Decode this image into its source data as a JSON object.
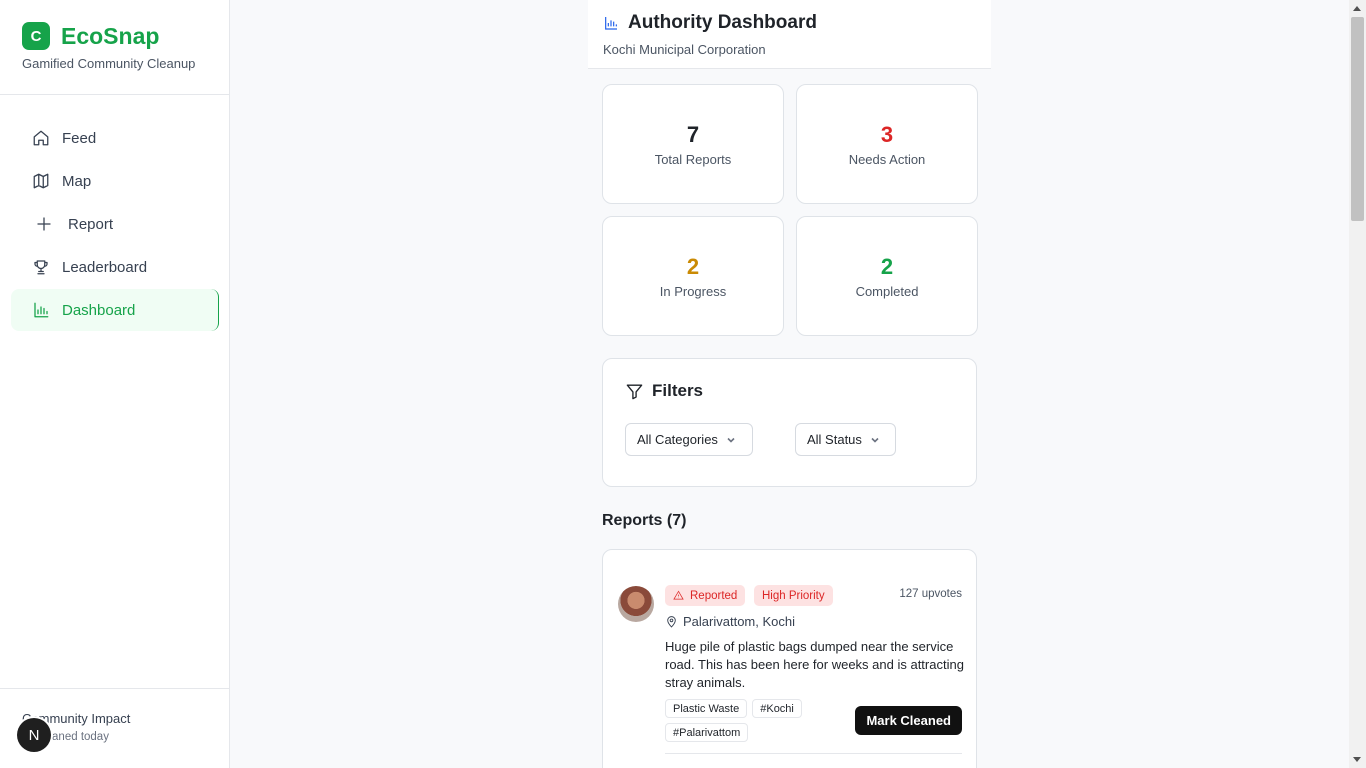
{
  "brand": {
    "logo_letter": "C",
    "name": "EcoSnap",
    "tagline": "Gamified Community Cleanup"
  },
  "nav": [
    {
      "label": "Feed",
      "icon": "home-icon"
    },
    {
      "label": "Map",
      "icon": "map-icon"
    },
    {
      "label": "Report",
      "icon": "plus-icon"
    },
    {
      "label": "Leaderboard",
      "icon": "trophy-icon"
    },
    {
      "label": "Dashboard",
      "icon": "bar-chart-icon",
      "active": true
    }
  ],
  "impact": {
    "title": "Community Impact",
    "subtitle": "as cleaned today",
    "badge": "N"
  },
  "header": {
    "title": "Authority Dashboard",
    "subtitle": "Kochi Municipal Corporation"
  },
  "stats": [
    {
      "value": "7",
      "label": "Total Reports",
      "color": "#1f2329"
    },
    {
      "value": "3",
      "label": "Needs Action",
      "color": "#dc2626"
    },
    {
      "value": "2",
      "label": "In Progress",
      "color": "#ca8a04"
    },
    {
      "value": "2",
      "label": "Completed",
      "color": "#16a34a"
    }
  ],
  "filters": {
    "title": "Filters",
    "category": "All Categories",
    "status": "All Status"
  },
  "reports": {
    "title": "Reports (7)",
    "items": [
      {
        "status": "Reported",
        "priority": "High Priority",
        "upvotes": "127 upvotes",
        "location": "Palarivattom, Kochi",
        "description": "Huge pile of plastic bags dumped near the service road. This has been here for weeks and is attracting stray animals.",
        "tags": [
          "Plastic Waste",
          "#Kochi",
          "#Palarivattom"
        ],
        "action": "Mark Cleaned"
      }
    ]
  },
  "colors": {
    "accent": "#16a34a",
    "danger": "#dc2626",
    "warning": "#ca8a04"
  }
}
